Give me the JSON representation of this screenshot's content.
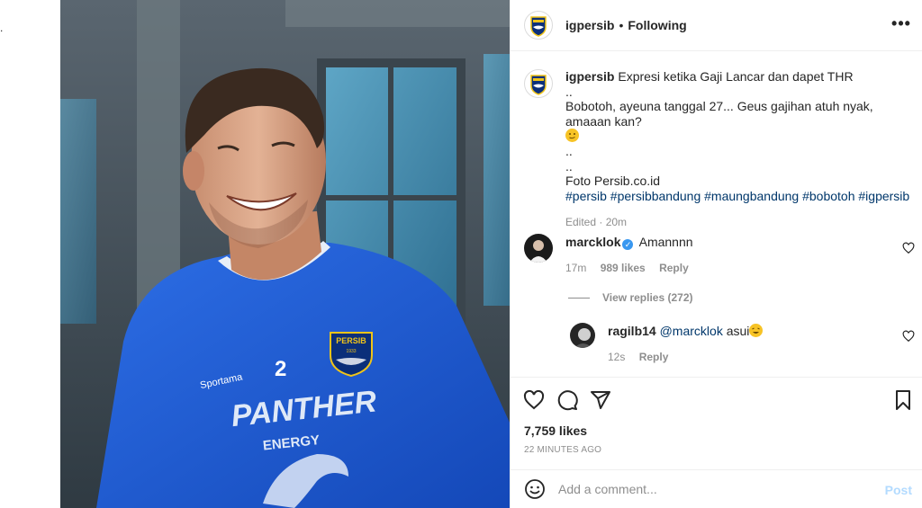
{
  "stray_mark": ".",
  "post": {
    "author": "igpersib",
    "separator": "•",
    "follow_status": "Following",
    "more_label": "•••"
  },
  "photo": {
    "jersey_brand": "PERSIB",
    "jersey_year": "1933",
    "jersey_number": "2",
    "sponsor_main": "PANTHER",
    "sponsor_sub": "ENERGY",
    "kit_maker": "Sportama"
  },
  "caption": {
    "username": "igpersib",
    "text": "Expresi ketika Gaji Lancar dan dapet THR",
    "line2": "..",
    "line3": "Bobotoh, ayeuna tanggal 27... Geus gajihan atuh nyak, amaaan kan?",
    "line4": "..",
    "line5": "..",
    "line6": "Foto Persib.co.id",
    "hashtags": "#persib #persibbandung #maungbandung #bobotoh #igpersib",
    "meta": "Edited · 20m"
  },
  "comment1": {
    "username": "marcklok",
    "verified_mark": "✓",
    "text": "Amannnn",
    "time": "17m",
    "likes": "989 likes",
    "reply_label": "Reply"
  },
  "view_replies": "View replies (272)",
  "reply1": {
    "username": "ragilb14",
    "mention": "@marcklok",
    "text": "asui",
    "time": "12s",
    "reply_label": "Reply"
  },
  "footer": {
    "likes": "7,759 likes",
    "time": "22 minutes ago",
    "comment_placeholder": "Add a comment...",
    "post_label": "Post"
  },
  "colors": {
    "jersey_blue": "#1f5fd6",
    "link_blue": "#00376b",
    "verified_blue": "#3897f0",
    "post_disabled": "#b3dbff"
  },
  "icons": [
    "more-icon",
    "heart-icon",
    "comment-icon",
    "share-icon",
    "bookmark-icon",
    "emoji-icon",
    "verified-icon"
  ]
}
